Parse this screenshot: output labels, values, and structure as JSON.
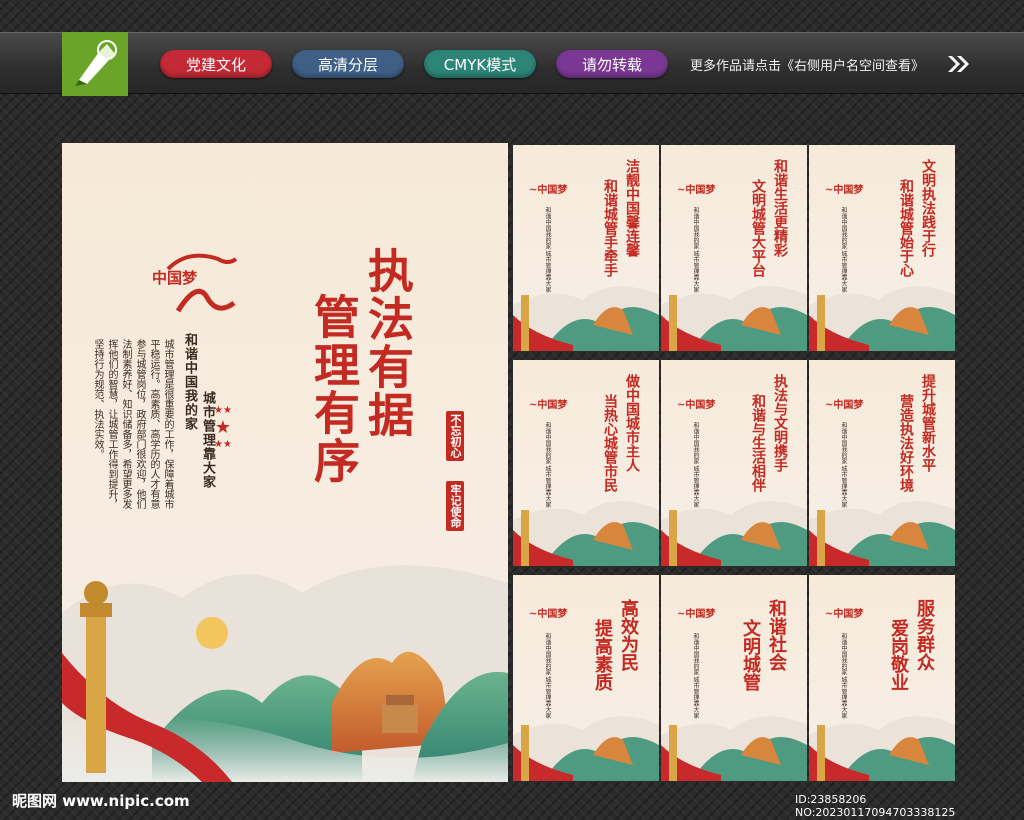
{
  "tags": [
    {
      "label": "党建文化",
      "color": "#c32a35"
    },
    {
      "label": "高清分层",
      "color": "#3f5f86"
    },
    {
      "label": "CMYK模式",
      "color": "#2d8577"
    },
    {
      "label": "请勿转载",
      "color": "#7a3894"
    }
  ],
  "more_text": "更多作品请点击《右侧用户名空间查看》",
  "main_poster": {
    "logo_text": "中国梦",
    "title_line1": "执法有据",
    "title_line2": "管理有序",
    "seal_line1": "不忘初心",
    "seal_line2": "牢记使命",
    "subtitle_line1": "和谐中国我的家",
    "subtitle_line2": "城市管理靠大家",
    "body_text": "城市管理是很重要的工作，保障着城市平稳运行。高素质、高学历的人才有意参与城管岗位，政府部门很欢迎，他们法制素养好、知识储备多，希望更多发挥他们的智慧，让城管工作得到提升，坚持行为规范、执法实效。"
  },
  "small_posters": [
    {
      "line1": "洁靓中国馨连馨",
      "line2": "和谐城管手牵手"
    },
    {
      "line1": "和谐生活更精彩",
      "line2": "文明城管大平台"
    },
    {
      "line1": "文明执法践于行",
      "line2": "和谐城管始于心"
    },
    {
      "line1": "做中国城市主人",
      "line2": "当热心城管市民"
    },
    {
      "line1": "执法与文明携手",
      "line2": "和谐与生活相伴"
    },
    {
      "line1": "提升城管新水平",
      "line2": "营造执法好环境"
    },
    {
      "line1": "高效为民",
      "line2": "提高素质"
    },
    {
      "line1": "和谐社会",
      "line2": "文明城管"
    },
    {
      "line1": "服务群众",
      "line2": "爱岗敬业"
    }
  ],
  "small_sub": "和谐中国我的家 城市管理靠大家",
  "footer": {
    "site": "昵图网 www.nipic.com",
    "id": "ID:23858206 NO:20230117094703338125"
  }
}
